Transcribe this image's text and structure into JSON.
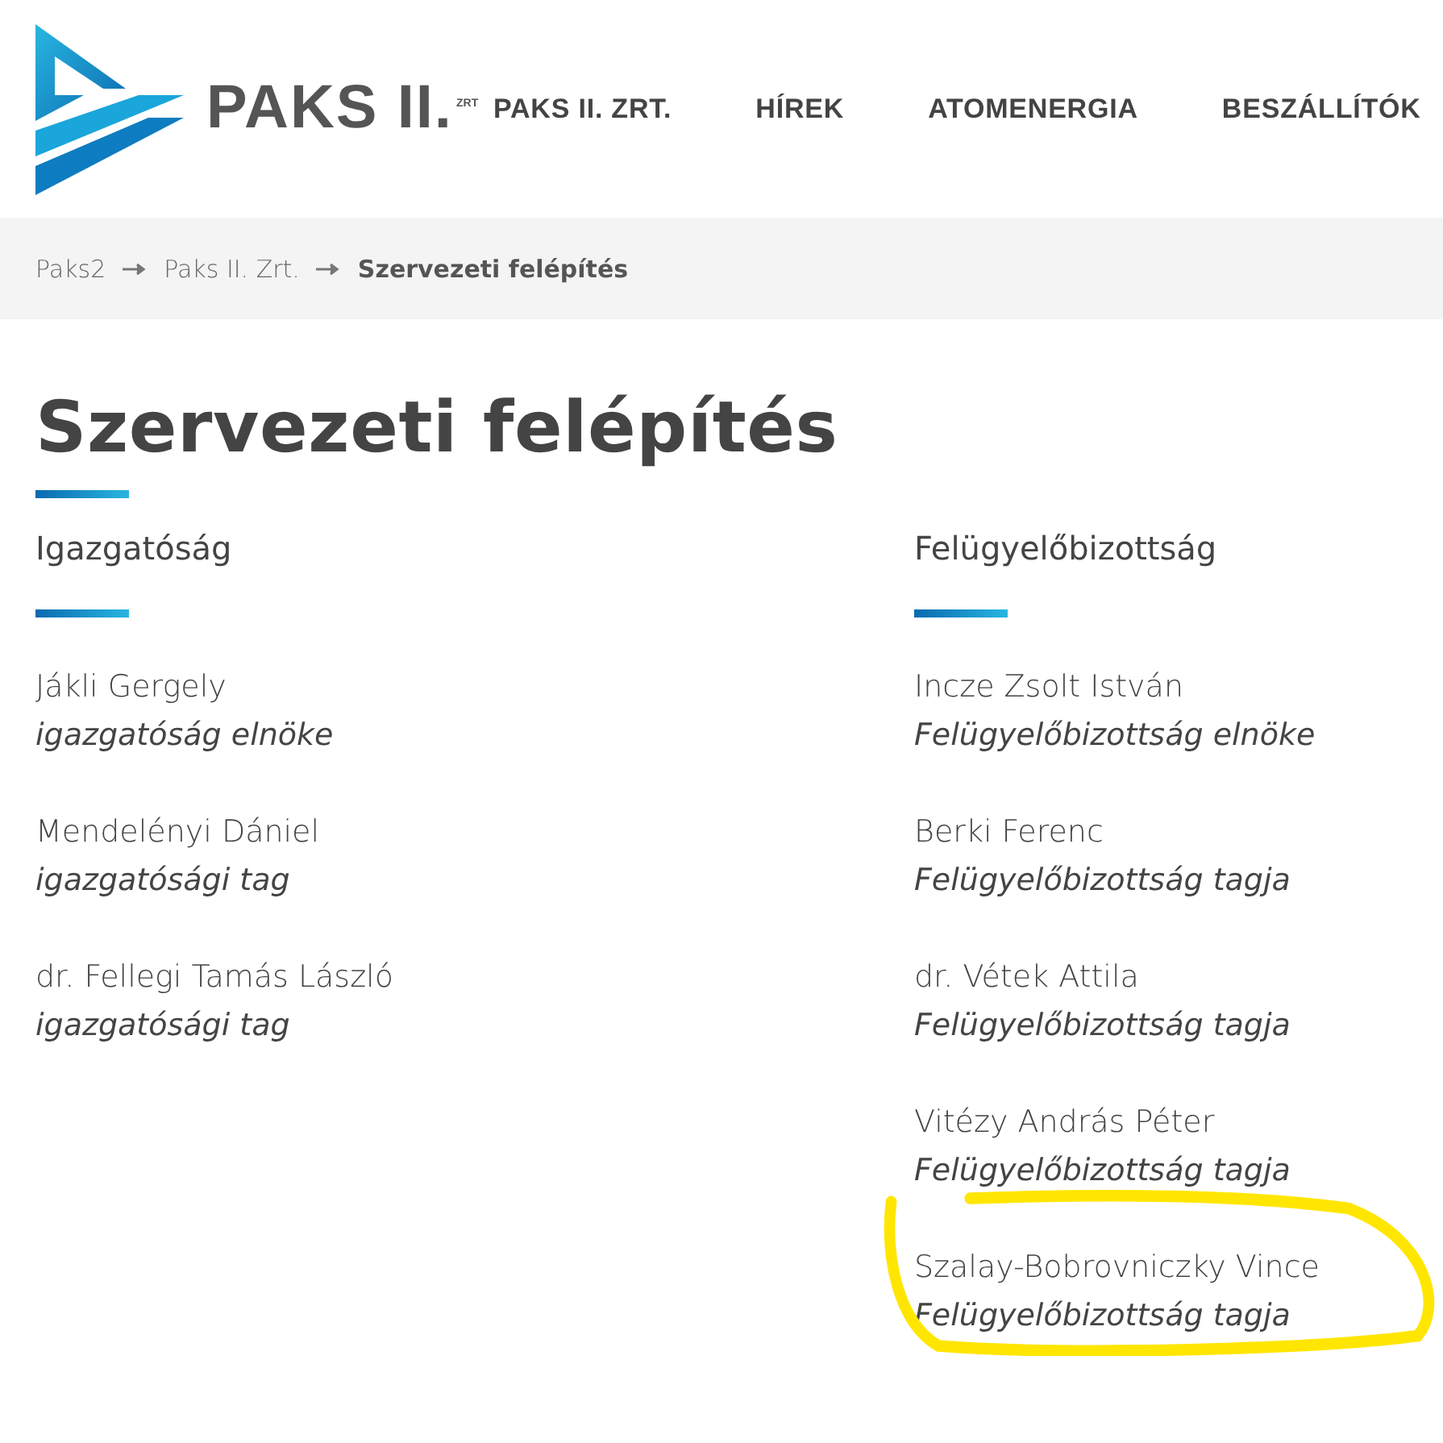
{
  "logo": {
    "text": "PAKS II.",
    "sup": "ZRT"
  },
  "nav": [
    {
      "label": "PAKS II. ZRT."
    },
    {
      "label": "HÍREK"
    },
    {
      "label": "ATOMENERGIA"
    },
    {
      "label": "BESZÁLLÍTÓK"
    }
  ],
  "breadcrumb": [
    {
      "label": "Paks2",
      "current": false
    },
    {
      "label": "Paks II. Zrt.",
      "current": false
    },
    {
      "label": "Szervezeti felépítés",
      "current": true
    }
  ],
  "title": "Szervezeti felépítés",
  "sections": [
    {
      "heading": "Igazgatóság",
      "members": [
        {
          "name": "Jákli Gergely",
          "role": "igazgatóság elnöke",
          "highlighted": false
        },
        {
          "name": "Mendelényi Dániel",
          "role": "igazgatósági tag",
          "highlighted": false
        },
        {
          "name": "dr. Fellegi Tamás László",
          "role": "igazgatósági tag",
          "highlighted": false
        }
      ]
    },
    {
      "heading": "Felügyelőbizottság",
      "members": [
        {
          "name": "Incze Zsolt István",
          "role": "Felügyelőbizottság elnöke",
          "highlighted": false
        },
        {
          "name": "Berki Ferenc",
          "role": "Felügyelőbizottság tagja",
          "highlighted": false
        },
        {
          "name": "dr. Vétek Attila",
          "role": "Felügyelőbizottság tagja",
          "highlighted": false
        },
        {
          "name": "Vitézy András Péter",
          "role": "Felügyelőbizottság tagja",
          "highlighted": false
        },
        {
          "name": "Szalay-Bobrovniczky Vince",
          "role": "Felügyelőbizottság tagja",
          "highlighted": true
        }
      ]
    }
  ]
}
